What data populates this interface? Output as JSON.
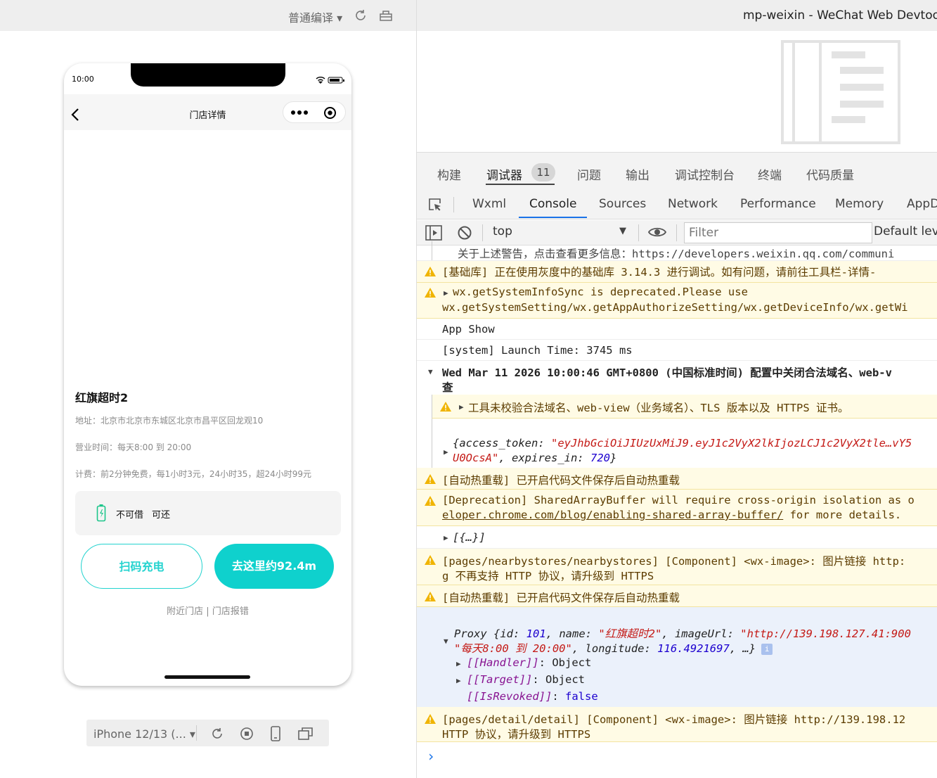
{
  "simulator": {
    "compile_mode": "普通编译",
    "status_time": "10:00",
    "nav_title": "门店详情",
    "store": {
      "name": "红旗超时2",
      "address": "地址：北京市北京市东城区北京市昌平区回龙观10",
      "hours": "营业时间：每天8:00 到 20:00",
      "fee": "计费：前2分钟免费，每1小时3元，24小时35，超24小时99元",
      "borrow": "不可借",
      "return": "可还"
    },
    "scan_button": "扫码充电",
    "go_button": "去这里约92.4m",
    "links": "附近门店 | 门店报错",
    "device": "iPhone 12/13 (..."
  },
  "devtools": {
    "window_title": "mp-weixin - WeChat Web Devtools",
    "top_tabs": [
      "构建",
      "调试器",
      "问题",
      "输出",
      "调试控制台",
      "终端",
      "代码质量"
    ],
    "debugger_badge": "11",
    "panel_tabs": [
      "Wxml",
      "Console",
      "Sources",
      "Network",
      "Performance",
      "Memory",
      "AppD"
    ],
    "context": "top",
    "filter_placeholder": "Filter",
    "levels": "Default lev",
    "accent_color": "#1a73e8",
    "warn_bg": "#fffbe5"
  },
  "console": {
    "l0": "关于上述警告，点击查看更多信息：https://developers.weixin.qq.com/communi",
    "l1": "[基础库] 正在使用灰度中的基础库 3.14.3 进行调试。如有问题，请前往工具栏-详情-",
    "l2a": "wx.getSystemInfoSync is deprecated.Please use",
    "l2b": "wx.getSystemSetting/wx.getAppAuthorizeSetting/wx.getDeviceInfo/wx.getWi",
    "l3": "App Show",
    "l4": "[system] Launch Time: 3745 ms",
    "l5a": "Wed Mar 11 2026 10:00:46 GMT+0800 (中国标准时间) 配置中关闭合法域名、web-v",
    "l5b": "查",
    "l6": "工具未校验合法域名、web-view（业务域名）、TLS 版本以及 HTTPS 证书。",
    "l7a_key": "{access_token: ",
    "l7a_val": "\"eyJhbGciOiJIUzUxMiJ9.eyJ1c2VyX2lkIjozLCJ1c2VyX2tle…vY5",
    "l7b_val": "U0OcsA\"",
    "l7b_rest": ", expires_in: ",
    "l7b_num": "720",
    "l7b_end": "}",
    "l8": "[自动热重载] 已开启代码文件保存后自动热重载",
    "l9a": "[Deprecation] SharedArrayBuffer will require cross-origin isolation as o",
    "l9b_link": "eloper.chrome.com/blog/enabling-shared-array-buffer/",
    "l9b_rest": " for more details.",
    "l10": "[{…}]",
    "l11a": "[pages/nearbystores/nearbystores] [Component] <wx-image>: 图片链接 http:",
    "l11b": "g 不再支持 HTTP 协议，请升级到 HTTPS",
    "l12": "[自动热重载] 已开启代码文件保存后自动热重载",
    "p_a1": "Proxy {id: ",
    "p_a2": "101",
    "p_a3": ", name: ",
    "p_a4": "\"红旗超时2\"",
    "p_a5": ", imageUrl: ",
    "p_a6": "\"http://139.198.127.41:900",
    "p_b1": "\"每天8:00 到 20:00\"",
    "p_b2": ", longitude: ",
    "p_b3": "116.4921697",
    "p_b4": ", …}",
    "p_c": "[[Handler]]",
    "p_c2": ": Object",
    "p_d": "[[Target]]",
    "p_d2": ": Object",
    "p_e": "[[IsRevoked]]",
    "p_e2": ": ",
    "p_e3": "false",
    "l13a": "[pages/detail/detail] [Component] <wx-image>: 图片链接 http://139.198.12",
    "l13b": "HTTP 协议，请升级到 HTTPS",
    "prompt": "›"
  }
}
